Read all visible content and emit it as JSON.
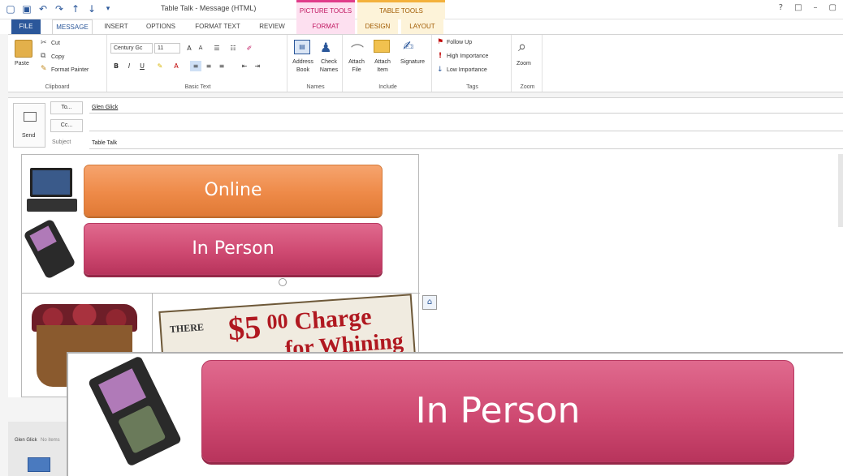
{
  "window": {
    "title": "Table Talk - Message (HTML)",
    "context_picture_tools": "PICTURE TOOLS",
    "context_table_tools": "TABLE TOOLS",
    "controls": [
      "?",
      "□",
      "–",
      "▢"
    ]
  },
  "tabs": {
    "file": "FILE",
    "message": "MESSAGE",
    "insert": "INSERT",
    "options": "OPTIONS",
    "format_text": "FORMAT TEXT",
    "review": "REVIEW",
    "format": "FORMAT",
    "design": "DESIGN",
    "layout": "LAYOUT"
  },
  "ribbon": {
    "clipboard": {
      "paste": "Paste",
      "cut": "Cut",
      "copy": "Copy",
      "format_painter": "Format Painter",
      "label": "Clipboard"
    },
    "basic_text": {
      "font": "Century Gc",
      "size": "11",
      "label": "Basic Text"
    },
    "names": {
      "address_book_1": "Address",
      "address_book_2": "Book",
      "check_names_1": "Check",
      "check_names_2": "Names",
      "label": "Names"
    },
    "include": {
      "attach_file_1": "Attach",
      "attach_file_2": "File",
      "attach_item_1": "Attach",
      "attach_item_2": "Item",
      "signature": "Signature",
      "label": "Include"
    },
    "tags": {
      "follow_up": "Follow Up",
      "high_importance": "High Importance",
      "low_importance": "Low Importance",
      "label": "Tags"
    },
    "zoom": {
      "zoom": "Zoom",
      "label": "Zoom"
    }
  },
  "compose": {
    "send": "Send",
    "to_btn": "To...",
    "to_value": "Glen Glick",
    "cc_btn": "Cc...",
    "cc_value": "",
    "subject_label": "Subject",
    "subject_value": "Table Talk"
  },
  "body": {
    "online": "Online",
    "in_person": "In Person",
    "sign_small": "THERE",
    "sign_big": "$5",
    "sign_sup": "00",
    "sign_word": "Charge",
    "sign_word2": "for Whining"
  },
  "zoom_overlay": {
    "in_person": "In Person"
  },
  "footer": {
    "sender": "Glen Glick",
    "status": "No items"
  },
  "colors": {
    "accent": "#2b579a",
    "orange_button": "#ee8a48",
    "pink_button": "#cf4a72",
    "picture_tools": "#c0155f",
    "table_tools": "#a05a00"
  }
}
